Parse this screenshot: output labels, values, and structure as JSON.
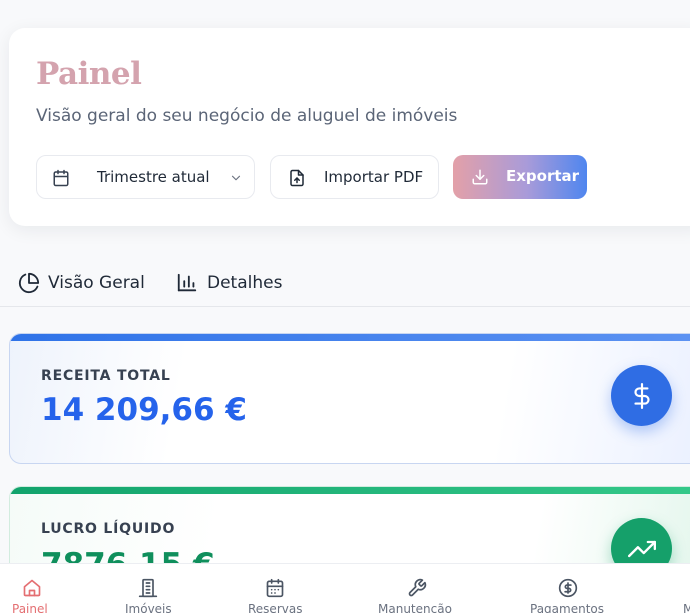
{
  "header": {
    "title": "Painel",
    "subtitle": "Visão geral do seu negócio de aluguel de imóveis",
    "period_select": {
      "value": "Trimestre atual"
    },
    "import_button": "Importar PDF",
    "export_button": "Exportar"
  },
  "tabs": [
    {
      "label": "Visão Geral",
      "icon": "pie-chart-icon",
      "active": true
    },
    {
      "label": "Detalhes",
      "icon": "bar-chart-icon",
      "active": false
    }
  ],
  "stats": {
    "revenue": {
      "label": "RECEITA TOTAL",
      "value": "14 209,66 €",
      "icon": "dollar-icon",
      "color": "#2563eb"
    },
    "profit": {
      "label": "LUCRO LÍQUIDO",
      "value": "7876,15 €",
      "icon": "trending-up-icon",
      "color": "#0f8f5c"
    }
  },
  "bottom_nav": [
    {
      "label": "Painel",
      "icon": "home-icon",
      "active": true
    },
    {
      "label": "Imóveis",
      "icon": "building-icon",
      "active": false
    },
    {
      "label": "Reservas",
      "icon": "calendar-icon",
      "active": false
    },
    {
      "label": "Manutenção",
      "icon": "wrench-icon",
      "active": false
    },
    {
      "label": "Pagamentos",
      "icon": "dollar-circle-icon",
      "active": false
    },
    {
      "label": "M",
      "icon": "more-icon",
      "active": false
    }
  ],
  "colors": {
    "title": "#d4a3ae",
    "accent_blue": "#2f6de4",
    "accent_green": "#15a06a",
    "active_nav": "#e46f72"
  }
}
